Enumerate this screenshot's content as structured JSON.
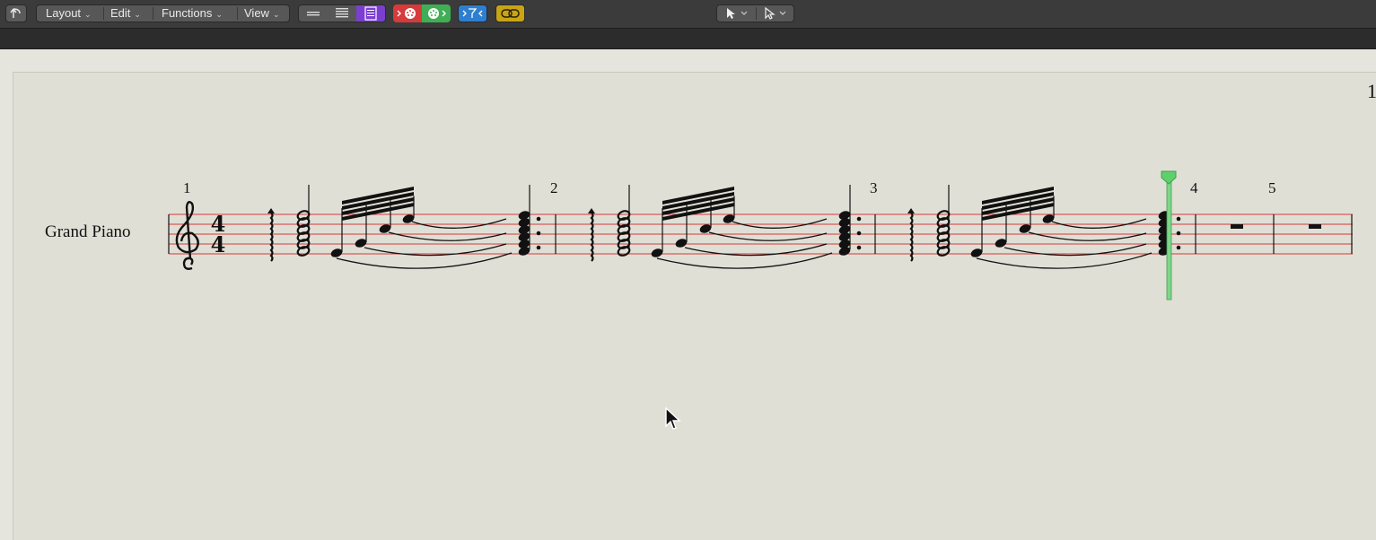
{
  "toolbar": {
    "menus": [
      {
        "label": "Layout"
      },
      {
        "label": "Edit"
      },
      {
        "label": "Functions"
      },
      {
        "label": "View"
      }
    ],
    "colors": {
      "toolbar_bg": "#3b3b3b",
      "view_mode_active": "#7a3fd1",
      "midi_out_red": "#d63a3a",
      "midi_in_green": "#3fae55",
      "filter_blue": "#2f7fd0",
      "link_yellow": "#c9a515"
    }
  },
  "score": {
    "instrument_name": "Grand Piano",
    "time_signature": {
      "numerator": "4",
      "denominator": "4"
    },
    "bar_numbers": [
      "1",
      "2",
      "3",
      "4",
      "5"
    ],
    "page_number_partial": "1",
    "playhead_color": "#5fcf6b",
    "staff_line_color": "#d23b3b"
  }
}
